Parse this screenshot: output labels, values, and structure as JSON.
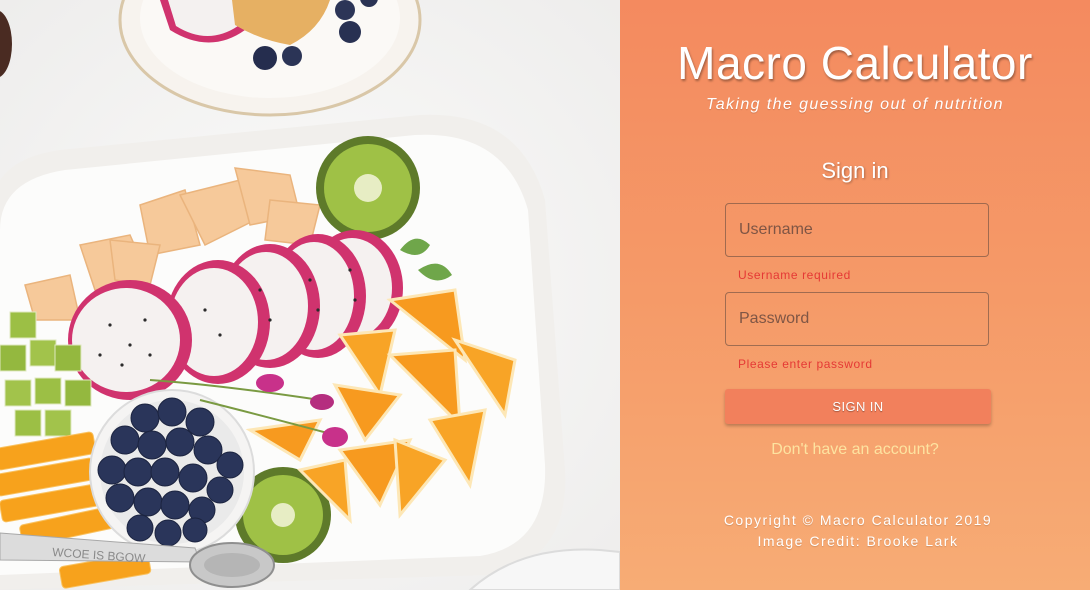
{
  "panel": {
    "title": "Macro Calculator",
    "tagline": "Taking the guessing out of nutrition",
    "heading": "Sign in",
    "colors": {
      "gradient_top": "#f48a5f",
      "gradient_bottom": "#f7ac75",
      "button": "#f2805c",
      "error": "#e53935",
      "link": "#fde3a0"
    }
  },
  "form": {
    "username": {
      "placeholder": "Username",
      "value": "",
      "error": "Username required"
    },
    "password": {
      "placeholder": "Password",
      "value": "",
      "error": "Please enter password"
    },
    "submit_label": "SIGN IN",
    "register_link": "Don't have an account?"
  },
  "footer": {
    "copyright": "Copyright © Macro Calculator 2019",
    "credit": "Image Credit: Brooke Lark"
  },
  "photo": {
    "subject": "fruit-platter-photo",
    "engraving": "WCOE IS BGOW"
  }
}
